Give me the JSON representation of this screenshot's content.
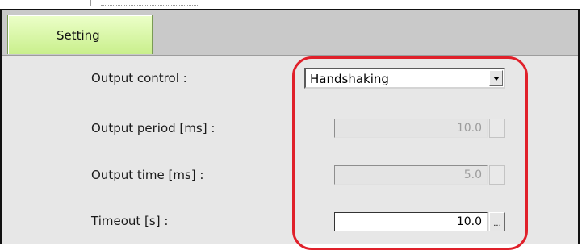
{
  "tab": {
    "label": "Setting"
  },
  "output_control": {
    "label": "Output control :",
    "value": "Handshaking"
  },
  "output_period": {
    "label": "Output period [ms] :",
    "value": "10.0"
  },
  "output_time": {
    "label": "Output time [ms] :",
    "value": "5.0"
  },
  "timeout": {
    "label": "Timeout [s] :",
    "value": "10.0"
  },
  "browse_button_label": "...",
  "highlight_color": "#e0202a",
  "tab_color": "#c9ef8c"
}
